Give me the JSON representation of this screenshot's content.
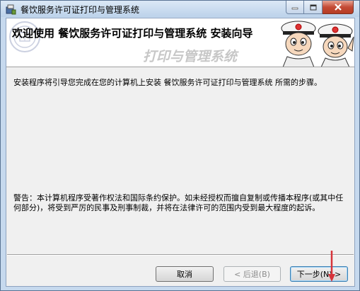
{
  "window": {
    "title": "餐饮服务许可证打印与管理系统"
  },
  "banner": {
    "title": "欢迎使用  餐饮服务许可证打印与管理系统  安装向导",
    "script_text": "打印与管理系统"
  },
  "content": {
    "intro": "安装程序将引导您完成在您的计算机上安装  餐饮服务许可证打印与管理系统  所需的步骤。",
    "warning": "警告：本计算机程序受著作权法和国际条约保护。如未经授权而擅自复制或传播本程序(或其中任何部分)，将受到严厉的民事及刑事制裁，并将在法律许可的范围内受到最大程度的起诉。"
  },
  "buttons": {
    "cancel": "取消",
    "back": "< 后退(B)",
    "next": "下一步(N) >"
  },
  "colors": {
    "annotation_arrow": "#d6333a"
  }
}
